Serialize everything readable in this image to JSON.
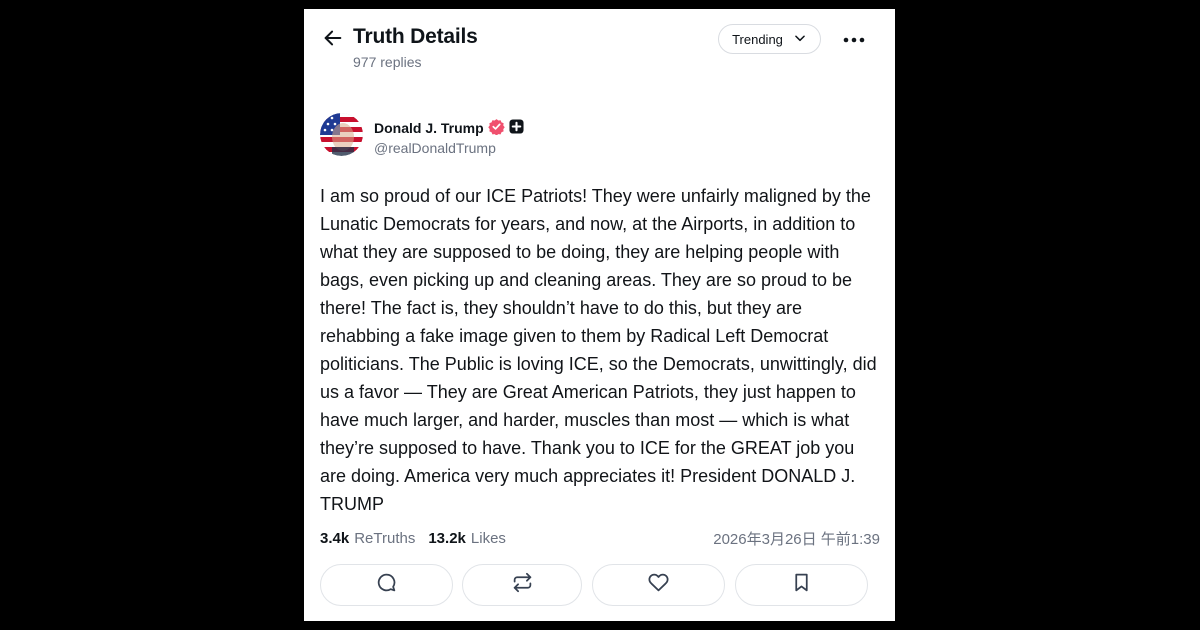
{
  "header": {
    "title": "Truth Details",
    "replies": "977 replies",
    "sort_label": "Trending"
  },
  "post": {
    "author": {
      "name": "Donald J. Trump",
      "handle": "@realDonaldTrump",
      "verified": true
    },
    "text": "I am so proud of our ICE Patriots! They were unfairly maligned by the Lunatic Democrats for years, and now, at the Airports, in addition to what they are supposed to be doing, they are helping people with bags, even picking up and cleaning areas. They are so proud to be there! The fact is, they shouldn’t have to do this, but they are rehabbing a fake image given to them by Radical Left Democrat politicians. The Public is loving ICE, so the Democrats, unwittingly, did us a favor — They are Great American Patriots, they just happen to have much larger, and harder, muscles than most — which is what they’re supposed to have. Thank you to ICE for the GREAT job you are doing. America very much appreciates it! President DONALD J. TRUMP",
    "stats": {
      "retruths_count": "3.4k",
      "retruths_label": "ReTruths",
      "likes_count": "13.2k",
      "likes_label": "Likes"
    },
    "timestamp": "2026年3月26日 午前1:39"
  },
  "icons": {
    "back": "arrow-left-icon",
    "sort": "chevron-down-icon",
    "more": "more-horizontal-icon",
    "verified": "verified-badge-icon",
    "plus": "plus-badge-icon",
    "reply": "comment-icon",
    "retruth": "repost-icon",
    "like": "heart-icon",
    "bookmark": "bookmark-icon"
  },
  "colors": {
    "verified": "#f0506e",
    "text": "#0f1419",
    "muted": "#6b7280",
    "border": "#e1e4e8"
  }
}
